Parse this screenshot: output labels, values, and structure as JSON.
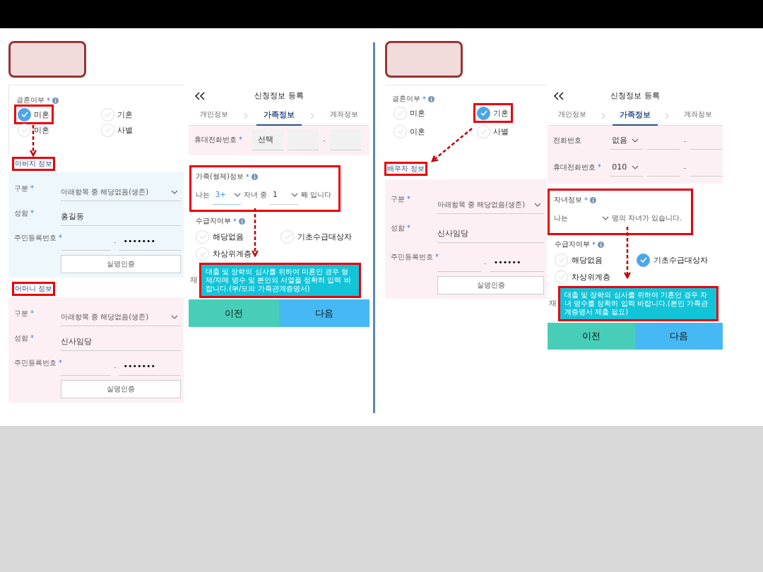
{
  "halves": [
    {
      "marital": {
        "label": "결혼여부",
        "required": "*",
        "options": [
          {
            "label": "미혼",
            "selected": true,
            "annotated": true
          },
          {
            "label": "기혼",
            "selected": false,
            "annotated": false
          },
          {
            "label": "이혼",
            "selected": false,
            "annotated": false
          },
          {
            "label": "사별",
            "selected": false,
            "annotated": false
          }
        ]
      },
      "sections": [
        {
          "title": "아버지 정보",
          "annotated": true,
          "color": "#eef7fc",
          "fields": [
            {
              "kind": "select",
              "label": "구분",
              "required": "*",
              "value": "아래항목 중 해당없음(생존)"
            },
            {
              "kind": "text",
              "label": "성함",
              "required": "*",
              "value": "홍길동"
            },
            {
              "kind": "id",
              "label": "주민등록번호",
              "required": "*",
              "separator": "-",
              "value": "•••••••"
            }
          ],
          "button": "실명인증"
        },
        {
          "title": "어머니 정보",
          "annotated": true,
          "color": "#fdf0f5",
          "fields": [
            {
              "kind": "select",
              "label": "구분",
              "required": "*",
              "value": "아래항목 중 해당없음(생존)"
            },
            {
              "kind": "text",
              "label": "성함",
              "required": "*",
              "value": "신사임당"
            },
            {
              "kind": "id",
              "label": "주민등록번호",
              "required": "*",
              "separator": "-",
              "value": "•••••••"
            }
          ],
          "button": "실명인증"
        }
      ],
      "phone": {
        "title": "신청정보 등록",
        "steps": [
          {
            "label": "개인정보",
            "selected": false
          },
          {
            "label": "가족정보",
            "selected": true
          },
          {
            "label": "계좌정보",
            "selected": false
          }
        ],
        "contacts": [
          {
            "kind": "boxed",
            "label": "휴대전화번호",
            "required": "*",
            "value": "선택",
            "separator": "-"
          }
        ],
        "family": {
          "title": "가족(형제)정보",
          "required": "*",
          "annotated": true,
          "parts": [
            {
              "kind": "text",
              "text": "나는"
            },
            {
              "kind": "select",
              "value": "3+",
              "active": true
            },
            {
              "kind": "text",
              "text": "자녀 중"
            },
            {
              "kind": "select",
              "value": "1",
              "active": false
            },
            {
              "kind": "text",
              "text": "째 입니다"
            }
          ]
        },
        "supply": {
          "label": "수급자여부",
          "required": "*",
          "options": [
            {
              "label": "해당없음",
              "selected": false
            },
            {
              "label": "기초수급대상자",
              "selected": false
            },
            {
              "label": "차상위계층",
              "selected": false
            }
          ]
        },
        "next_label": "재",
        "tooltip": {
          "text": "대출 및 장학의 심사를 위하여 미혼인 경우 형제/자매 명수 및 본인의 서열을 정확히 입력 바랍니다.(부/모의 가족관계증명서)",
          "annotated": true
        },
        "buttons": [
          {
            "kind": "prev",
            "label": "이전"
          },
          {
            "kind": "next",
            "label": "다음"
          }
        ]
      }
    },
    {
      "marital": {
        "label": "결혼여부",
        "required": "*",
        "options": [
          {
            "label": "미혼",
            "selected": false,
            "annotated": false
          },
          {
            "label": "기혼",
            "selected": true,
            "annotated": true
          },
          {
            "label": "이혼",
            "selected": false,
            "annotated": false
          },
          {
            "label": "사별",
            "selected": false,
            "annotated": false
          }
        ]
      },
      "sections": [
        {
          "title": "배우자 정보",
          "annotated": true,
          "color": "#fdf0f5",
          "fields": [
            {
              "kind": "select",
              "label": "구분",
              "required": "*",
              "value": "아래항목 중 해당없음(생존)"
            },
            {
              "kind": "text",
              "label": "성함",
              "required": "*",
              "value": "신사임당"
            },
            {
              "kind": "id",
              "label": "주민등록번호",
              "required": "*",
              "separator": "-",
              "value": "••••••"
            }
          ],
          "button": "실명인증"
        }
      ],
      "phone": {
        "title": "신청정보 등록",
        "steps": [
          {
            "label": "개인정보",
            "selected": false
          },
          {
            "label": "가족정보",
            "selected": true
          },
          {
            "label": "계좌정보",
            "selected": false
          }
        ],
        "contacts": [
          {
            "kind": "underlined",
            "label": "전화번호",
            "value": "없음",
            "separator": "-"
          },
          {
            "kind": "underlined",
            "label": "휴대전화번호",
            "required": "*",
            "value": "010",
            "separator": "-"
          }
        ],
        "family": {
          "title": "자녀정보",
          "required": "*",
          "annotated": true,
          "parts": [
            {
              "kind": "text",
              "text": "나는"
            },
            {
              "kind": "select"
            },
            {
              "kind": "text",
              "text": "명의 자녀가 있습니다."
            }
          ]
        },
        "supply": {
          "label": "수급자여부",
          "required": "*",
          "options": [
            {
              "label": "해당없음",
              "selected": false
            },
            {
              "label": "기초수급대상자",
              "selected": true
            },
            {
              "label": "차상위계층",
              "selected": false
            }
          ]
        },
        "next_label": "재",
        "tooltip": {
          "text": "대출 및 장학의 심사를 위하여 기혼인 경우 자녀 명수를 정확히 입력 바랍니다.(본인 가족관계증명서 제출 필요)",
          "annotated": true
        },
        "buttons": [
          {
            "kind": "prev",
            "label": "이전"
          },
          {
            "kind": "next",
            "label": "다음"
          }
        ]
      }
    }
  ]
}
